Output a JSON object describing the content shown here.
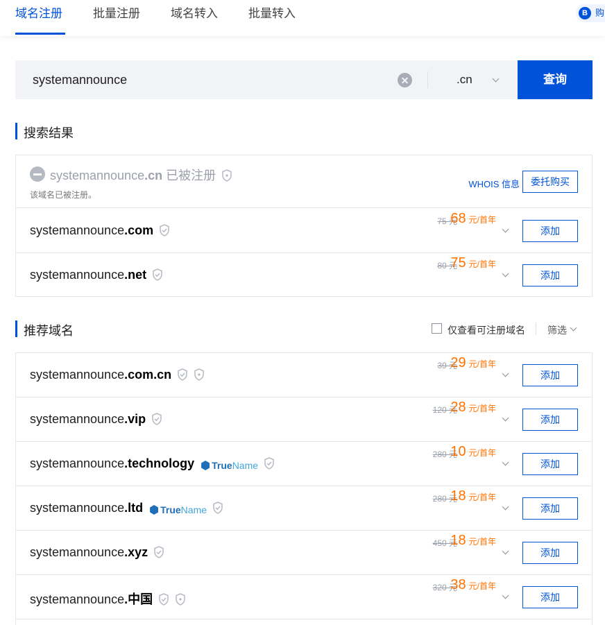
{
  "tabs": [
    {
      "label": "域名注册",
      "active": true
    },
    {
      "label": "批量注册",
      "active": false
    },
    {
      "label": "域名转入",
      "active": false
    },
    {
      "label": "批量转入",
      "active": false
    }
  ],
  "cart": {
    "icon_letter": "B",
    "label": "购"
  },
  "search": {
    "value": "systemannounce",
    "tld": ".cn",
    "button_label": "查询"
  },
  "results_section": {
    "title": "搜索结果",
    "taken": {
      "name": "systemannounce",
      "tld": ".cn",
      "status": "已被注册",
      "note": "该域名已被注册。",
      "whois_label": "WHOIS 信息",
      "agent_label": "委托购买"
    },
    "rows": [
      {
        "name": "systemannounce",
        "tld": ".com",
        "original_price": "75 元",
        "price": "68",
        "unit": "元/首年",
        "add_label": "添加",
        "icons": [
          "shield-check"
        ]
      },
      {
        "name": "systemannounce",
        "tld": ".net",
        "original_price": "80 元",
        "price": "75",
        "unit": "元/首年",
        "add_label": "添加",
        "icons": [
          "shield-check"
        ]
      }
    ]
  },
  "recommend_section": {
    "title": "推荐域名",
    "filter_checkbox_label": "仅查看可注册域名",
    "filter_label": "筛选",
    "rows": [
      {
        "name": "systemannounce",
        "tld": ".com.cn",
        "original_price": "39 元",
        "price": "29",
        "unit": "元/首年",
        "add_label": "添加",
        "truename": false,
        "extra_shield": true
      },
      {
        "name": "systemannounce",
        "tld": ".vip",
        "original_price": "120 元",
        "price": "28",
        "unit": "元/首年",
        "add_label": "添加",
        "truename": false,
        "extra_shield": false
      },
      {
        "name": "systemannounce",
        "tld": ".technology",
        "original_price": "280 元",
        "price": "10",
        "unit": "元/首年",
        "add_label": "添加",
        "truename": true,
        "extra_shield": false
      },
      {
        "name": "systemannounce",
        "tld": ".ltd",
        "original_price": "280 元",
        "price": "18",
        "unit": "元/首年",
        "add_label": "添加",
        "truename": true,
        "extra_shield": false
      },
      {
        "name": "systemannounce",
        "tld": ".xyz",
        "original_price": "450 元",
        "price": "18",
        "unit": "元/首年",
        "add_label": "添加",
        "truename": false,
        "extra_shield": false
      },
      {
        "name": "systemannounce",
        "tld": ".中国",
        "original_price": "320 元",
        "price": "38",
        "unit": "元/首年",
        "add_label": "添加",
        "truename": false,
        "extra_shield": true
      }
    ]
  },
  "truename": {
    "part1": "True",
    "part2": "Name"
  },
  "colors": {
    "primary": "#0052d9",
    "price": "#ff7200",
    "muted": "#9aa0aa"
  }
}
